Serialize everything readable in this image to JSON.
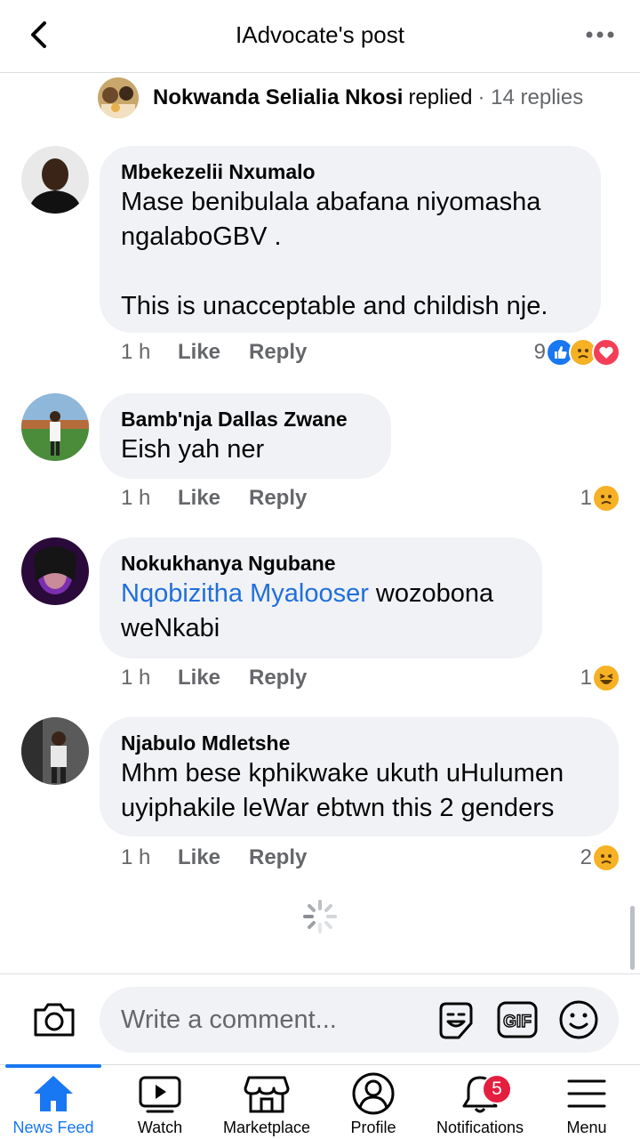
{
  "header": {
    "title": "IAdvocate's post"
  },
  "replied_row": {
    "name": "Nokwanda Selialia Nkosi",
    "action": "replied",
    "count": "· 14 replies"
  },
  "comments": [
    {
      "author": "Mbekezelii Nxumalo",
      "text": "Mase benibulala abafana niyomasha ngalaboGBV .\n\nThis is unacceptable and childish nje.",
      "time": "1 h",
      "like": "Like",
      "reply": "Reply",
      "reaction_count": "9",
      "reactions": [
        "like",
        "sad",
        "love"
      ]
    },
    {
      "author": "Bamb'nja Dallas Zwane",
      "text": "Eish yah ner",
      "time": "1 h",
      "like": "Like",
      "reply": "Reply",
      "reaction_count": "1",
      "reactions": [
        "sad"
      ]
    },
    {
      "author": "Nokukhanya Ngubane",
      "mention": "Nqobizitha Myalooser",
      "text": " wozobona weNkabi",
      "time": "1 h",
      "like": "Like",
      "reply": "Reply",
      "reaction_count": "1",
      "reactions": [
        "haha"
      ]
    },
    {
      "author": "Njabulo Mdletshe",
      "text": "Mhm bese kphikwake ukuth uHulumen uyiphakile leWar ebtwn this 2 genders",
      "time": "1 h",
      "like": "Like",
      "reply": "Reply",
      "reaction_count": "2",
      "reactions": [
        "sad"
      ]
    }
  ],
  "composer": {
    "placeholder": "Write a comment..."
  },
  "bottom_nav": {
    "items": [
      {
        "label": "News Feed",
        "icon": "home-icon"
      },
      {
        "label": "Watch",
        "icon": "watch-icon"
      },
      {
        "label": "Marketplace",
        "icon": "marketplace-icon"
      },
      {
        "label": "Profile",
        "icon": "profile-icon"
      },
      {
        "label": "Notifications",
        "icon": "bell-icon",
        "badge": "5"
      },
      {
        "label": "Menu",
        "icon": "menu-icon"
      }
    ]
  },
  "colors": {
    "brand": "#1877f2",
    "bubble": "#f0f2f5",
    "muted": "#65676b",
    "mention": "#216fdb",
    "badge": "#e41e3f"
  }
}
